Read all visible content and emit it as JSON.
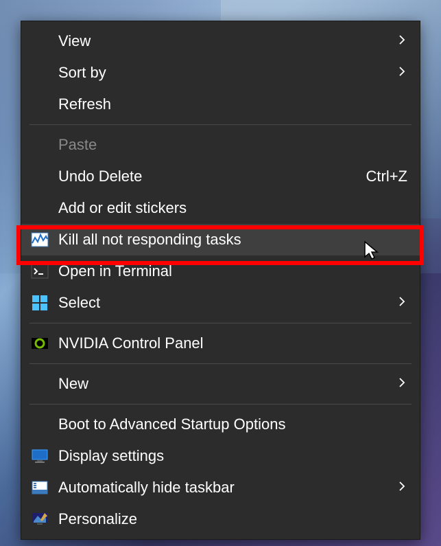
{
  "menu": {
    "items": [
      {
        "label": "View",
        "hasSubmenu": true
      },
      {
        "label": "Sort by",
        "hasSubmenu": true
      },
      {
        "label": "Refresh"
      }
    ],
    "items2": [
      {
        "label": "Paste",
        "disabled": true
      },
      {
        "label": "Undo Delete",
        "shortcut": "Ctrl+Z"
      },
      {
        "label": "Add or edit stickers"
      },
      {
        "label": "Kill all not responding tasks",
        "icon": "taskmgr",
        "highlighted": true,
        "hovered": true
      },
      {
        "label": "Open in Terminal",
        "icon": "terminal"
      },
      {
        "label": "Select",
        "icon": "windows",
        "hasSubmenu": true
      }
    ],
    "items3": [
      {
        "label": "NVIDIA Control Panel",
        "icon": "nvidia"
      }
    ],
    "items4": [
      {
        "label": "New",
        "hasSubmenu": true
      }
    ],
    "items5": [
      {
        "label": "Boot to Advanced Startup Options"
      },
      {
        "label": "Display settings",
        "icon": "display"
      },
      {
        "label": "Automatically hide taskbar",
        "icon": "taskbar",
        "hasSubmenu": true
      },
      {
        "label": "Personalize",
        "icon": "personalize"
      }
    ]
  }
}
